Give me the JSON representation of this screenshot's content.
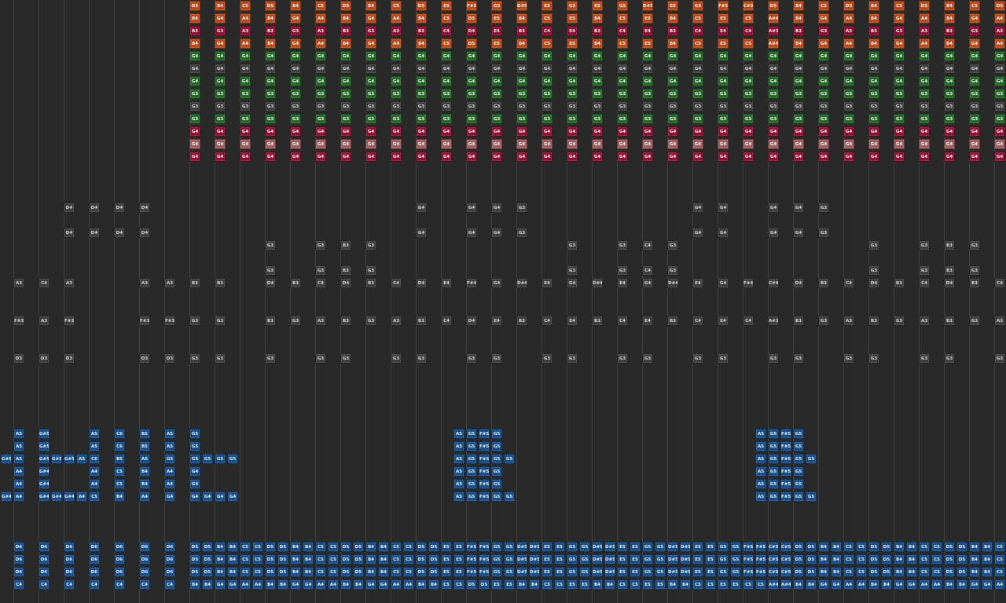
{
  "title": "",
  "colors": {
    "background": "#292929",
    "gridline": "#3f3f3f",
    "orange": "#b34c1e",
    "crimson": "#8c1238",
    "green": "#26692b",
    "gray": "#3e3e3e",
    "pink": "#9e5f5f",
    "blue": "#1c4f86"
  },
  "leadVoice": {
    "d5": [
      "D5",
      "B4",
      "C5",
      "D5",
      "B4",
      "C5",
      "D5",
      "B4",
      "C5",
      "D5",
      "E5",
      "F#5",
      "G5",
      "D#5",
      "E5",
      "G5",
      "E5",
      "G5",
      "D#5",
      "E5",
      "G5",
      "F#5",
      "C#5",
      "D5",
      "B4",
      "C5",
      "D5",
      "B4",
      "C5",
      "D5",
      "B4",
      "C5"
    ],
    "b4": [
      "B4",
      "G4",
      "A4",
      "B4",
      "G4",
      "A4",
      "B4",
      "G4",
      "A4",
      "B4",
      "C5",
      "D5",
      "E5",
      "B4",
      "C5",
      "E5",
      "B4",
      "C5",
      "E5",
      "B4",
      "C5",
      "E5",
      "C5",
      "A#4",
      "B4",
      "G4",
      "A4",
      "B4",
      "G4",
      "A4",
      "B4",
      "G4",
      "A4"
    ],
    "b3": [
      "B3",
      "G3",
      "A3",
      "B3",
      "G3",
      "A3",
      "B3",
      "G3",
      "A3",
      "B3",
      "C4",
      "D4",
      "E4",
      "B3",
      "C4",
      "E4",
      "B3",
      "C4",
      "E4",
      "B3",
      "C4",
      "E4",
      "C4",
      "A#3",
      "B3",
      "G3",
      "A3",
      "B3",
      "G3",
      "A3",
      "B3",
      "G3",
      "A3"
    ],
    "b4b": [
      "B4",
      "G4",
      "A4",
      "B4",
      "G4",
      "A4",
      "B4",
      "G4",
      "A4",
      "B4",
      "C5",
      "D5",
      "E5",
      "B4",
      "C5",
      "E5",
      "B4",
      "C5",
      "E5",
      "B4",
      "C5",
      "E5",
      "C5",
      "A#4",
      "B4",
      "G4",
      "A4",
      "B4",
      "G4",
      "A4",
      "B4",
      "G4",
      "A4"
    ],
    "g4": "G4",
    "g3": "G3"
  },
  "chords": {
    "row_d4": [
      "D4",
      "D4",
      "D4",
      "D4"
    ],
    "row_g4_a": [
      "G4",
      "G4",
      "G4",
      "G4",
      "G3",
      "G4",
      "G4",
      "G4",
      "G4",
      "G4",
      "G4",
      "G3"
    ],
    "row_g3": [
      "G3",
      "G3",
      "B3",
      "G3",
      "G3",
      "G3",
      "C4",
      "G3",
      "G3",
      "G3",
      "B3",
      "G3"
    ],
    "row_a3": [
      "A3",
      "C4",
      "A3",
      "A3",
      "A3",
      "B3",
      "B3",
      "D4",
      "B3",
      "C4",
      "D4",
      "B3",
      "C4",
      "D4",
      "E4",
      "F#4",
      "G4",
      "D#4",
      "E4",
      "G4",
      "D#4",
      "E4",
      "G4",
      "D#4",
      "E4",
      "G4",
      "F#4",
      "C#4",
      "D4",
      "B3",
      "C4",
      "D4",
      "B3",
      "C4",
      "D4",
      "B3",
      "C4"
    ],
    "row_fs3": [
      "F#3",
      "A3",
      "F#3",
      "F#3",
      "F#3",
      "G3",
      "G3",
      "B3",
      "G3",
      "A3",
      "B3",
      "G3",
      "A3",
      "B3",
      "C4",
      "D4",
      "E4",
      "B3",
      "C4",
      "E4",
      "B3",
      "C4",
      "E4",
      "B3",
      "C4",
      "E4",
      "C4",
      "A#3",
      "B3",
      "G3",
      "A3",
      "B3",
      "G3",
      "A3",
      "B3",
      "G3",
      "A3"
    ],
    "row_d3": [
      "D3",
      "D3",
      "D3",
      "D3",
      "D3",
      "G3",
      "G3",
      "G3",
      "G3",
      "G3",
      "G3",
      "G3",
      "G3",
      "G3",
      "G3",
      "G3",
      "G3",
      "G3",
      "G3",
      "G3",
      "G3",
      "G3",
      "G3",
      "G3",
      "G3"
    ]
  },
  "bass": {
    "top": [
      "A5",
      "G#5",
      "A5",
      "C6",
      "B5",
      "A5",
      "G5"
    ],
    "mid": [
      "A5",
      "G#5",
      "A5",
      "C6",
      "B5",
      "A5",
      "G5"
    ],
    "row3": [
      "G#5",
      "A5",
      "G#5",
      "G#5",
      "G#5",
      "A5",
      "C6",
      "B5",
      "A5",
      "G5",
      "G5",
      "G5",
      "G5"
    ],
    "row4": [
      "A4",
      "G#4",
      "A4",
      "C5",
      "B4",
      "A4",
      "G4"
    ],
    "row5": [
      "A4",
      "G#4",
      "A4",
      "C5",
      "B4",
      "A4",
      "G4"
    ],
    "row6": [
      "G#4",
      "A4",
      "G#4",
      "G#4",
      "G#4",
      "A4",
      "C5",
      "B4",
      "A4",
      "G4",
      "G4",
      "G4",
      "G4"
    ],
    "cluster": [
      "A5",
      "G5",
      "F#5",
      "G5",
      "G5"
    ]
  },
  "pedal": {
    "left_d6": "D6",
    "left_c4": "C4",
    "run_top": [
      "D5",
      "D5",
      "B4",
      "B4",
      "C5",
      "C5",
      "D5",
      "D5",
      "B4",
      "B4",
      "C5",
      "C5",
      "D5",
      "D5",
      "B4",
      "B4",
      "C5",
      "C5",
      "D5",
      "D5",
      "E5",
      "E5",
      "F#5",
      "F#5",
      "G5",
      "G5",
      "D#5",
      "D#5",
      "E5",
      "E5",
      "G5",
      "G5",
      "D#5",
      "D#5",
      "E5",
      "E5",
      "G5",
      "G5",
      "D#5",
      "D#5",
      "E5",
      "E5",
      "G5",
      "G5",
      "F#5",
      "F#5",
      "C#5",
      "C#5",
      "D5",
      "D5",
      "B4",
      "B4",
      "C5",
      "C5",
      "D5",
      "D5",
      "B4",
      "B4",
      "C5",
      "C5",
      "D5",
      "D5",
      "B4",
      "B4",
      "C5"
    ],
    "run_bottom": [
      "B4",
      "B4",
      "G4",
      "G4",
      "A4",
      "A4",
      "B4",
      "B4",
      "G4",
      "G4",
      "A4",
      "A4",
      "B4",
      "B4",
      "G4",
      "G4",
      "A4",
      "A4",
      "B4",
      "B4",
      "C5",
      "C5",
      "D5",
      "D5",
      "E5",
      "E5",
      "B4",
      "B4",
      "C5",
      "C5",
      "E5",
      "E5",
      "B4",
      "B4",
      "C5",
      "C5",
      "E5",
      "E5",
      "B4",
      "B4",
      "C5",
      "C5",
      "E5",
      "E5",
      "C5",
      "C5",
      "A#4",
      "A#4",
      "B4",
      "B4",
      "G4",
      "G4",
      "A4",
      "A4",
      "B4",
      "B4",
      "G4",
      "G4",
      "A4",
      "A4",
      "B4",
      "B4",
      "G4",
      "G4",
      "A4"
    ]
  }
}
